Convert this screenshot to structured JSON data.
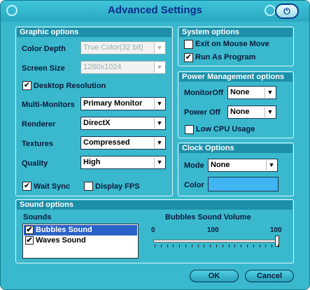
{
  "window": {
    "title": "Advanced Settings",
    "power_icon": "power-icon"
  },
  "graphic": {
    "title": "Graphic options",
    "color_depth": {
      "label": "Color Depth",
      "value": "True Color(32 bit)"
    },
    "screen_size": {
      "label": "Screen Size",
      "value": "1280x1024"
    },
    "desktop_resolution": {
      "label": "Desktop Resolution",
      "checked": true
    },
    "multi_monitors": {
      "label": "Multi-Monitors",
      "value": "Primary Monitor"
    },
    "renderer": {
      "label": "Renderer",
      "value": "DirectX"
    },
    "textures": {
      "label": "Textures",
      "value": "Compressed"
    },
    "quality": {
      "label": "Quality",
      "value": "High"
    },
    "wait_sync": {
      "label": "Wait Sync",
      "checked": true
    },
    "display_fps": {
      "label": "Display FPS",
      "checked": false
    }
  },
  "system": {
    "title": "System options",
    "exit_on_mouse_move": {
      "label": "Exit on Mouse Move",
      "checked": false
    },
    "run_as_program": {
      "label": "Run As Program",
      "checked": true
    }
  },
  "power": {
    "title": "Power Management options",
    "monitor_off": {
      "label": "MonitorOff",
      "value": "None"
    },
    "power_off": {
      "label": "Power Off",
      "value": "None"
    },
    "low_cpu": {
      "label": "Low CPU Usage",
      "checked": false
    }
  },
  "clock": {
    "title": "Clock Options",
    "mode": {
      "label": "Mode",
      "value": "None"
    },
    "color": {
      "label": "Color",
      "value": "#41b4f2"
    }
  },
  "sound": {
    "title": "Sound options",
    "sounds_label": "Sounds",
    "items": [
      {
        "label": "Bubbles Sound",
        "checked": true,
        "selected": true
      },
      {
        "label": "Waves Sound",
        "checked": true,
        "selected": false
      }
    ],
    "volume": {
      "label": "Bubbles Sound Volume",
      "min_label": "0",
      "mid_label": "100",
      "max_label": "100",
      "value_fraction": 1.0
    }
  },
  "buttons": {
    "ok": "OK",
    "cancel": "Cancel"
  },
  "colors": {
    "window_bg": "#3ab9ce",
    "title_text": "#0d2d8a",
    "selection": "#2b62c7"
  }
}
